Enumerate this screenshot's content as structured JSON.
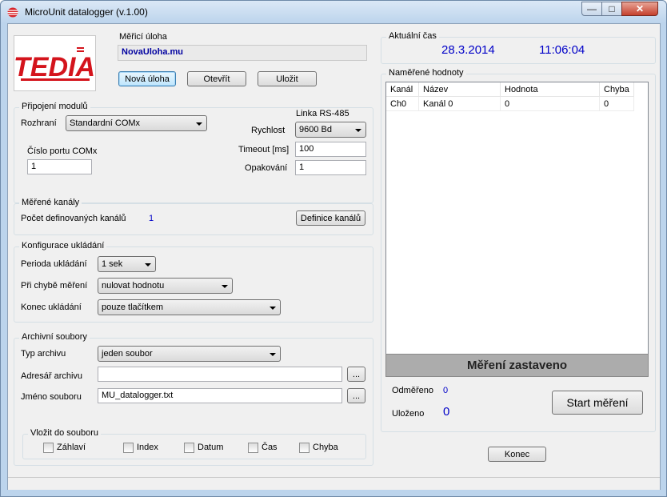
{
  "window": {
    "title": "MicroUnit datalogger  (v.1.00)"
  },
  "logo": {
    "text": "TEDIA"
  },
  "task": {
    "label": "Měřicí úloha",
    "name": "NovaUloha.mu",
    "new_button": "Nová úloha",
    "open_button": "Otevřít",
    "save_button": "Uložit"
  },
  "module": {
    "group_title": "Připojení modulů",
    "interface_label": "Rozhraní",
    "interface_value": "Standardní COMx",
    "port_label": "Číslo portu COMx",
    "port_value": "1",
    "rs485_label": "Linka RS-485",
    "speed_label": "Rychlost",
    "speed_value": "9600 Bd",
    "timeout_label": "Timeout [ms]",
    "timeout_value": "100",
    "repeat_label": "Opakování",
    "repeat_value": "1"
  },
  "channels": {
    "group_title": "Měřené kanály",
    "count_label": "Počet definovaných kanálů",
    "count_value": "1",
    "define_button": "Definice kanálů"
  },
  "storage": {
    "group_title": "Konfigurace ukládání",
    "period_label": "Perioda ukládání",
    "period_value": "1 sek",
    "error_label": "Při chybě měření",
    "error_value": "nulovat hodnotu",
    "end_label": "Konec ukládání",
    "end_value": "pouze tlačítkem"
  },
  "archive": {
    "group_title": "Archivní soubory",
    "type_label": "Typ archivu",
    "type_value": "jeden soubor",
    "dir_label": "Adresář archivu",
    "dir_value": "",
    "file_label": "Jméno souboru",
    "file_value": "MU_datalogger.txt",
    "browse_label": "...",
    "insert_group_title": "Vložit do souboru",
    "options": [
      "Záhlaví",
      "Index",
      "Datum",
      "Čas",
      "Chyba"
    ]
  },
  "time": {
    "label": "Aktuální čas",
    "date": "28.3.2014",
    "clock": "11:06:04"
  },
  "measured": {
    "group_title": "Naměřené hodnoty",
    "columns": [
      "Kanál",
      "Název",
      "Hodnota",
      "Chyba"
    ],
    "rows": [
      [
        "Ch0",
        "Kanál 0",
        "0",
        "0"
      ]
    ],
    "status": "Měření zastaveno",
    "measured_label": "Odměřeno",
    "measured_value": "0",
    "saved_label": "Uloženo",
    "saved_value": "0",
    "start_button": "Start měření"
  },
  "exit_button": "Konec",
  "colors": {
    "accent_blue": "#0000c8",
    "status_panel": "#acacac",
    "logo_red": "#d4141c"
  }
}
